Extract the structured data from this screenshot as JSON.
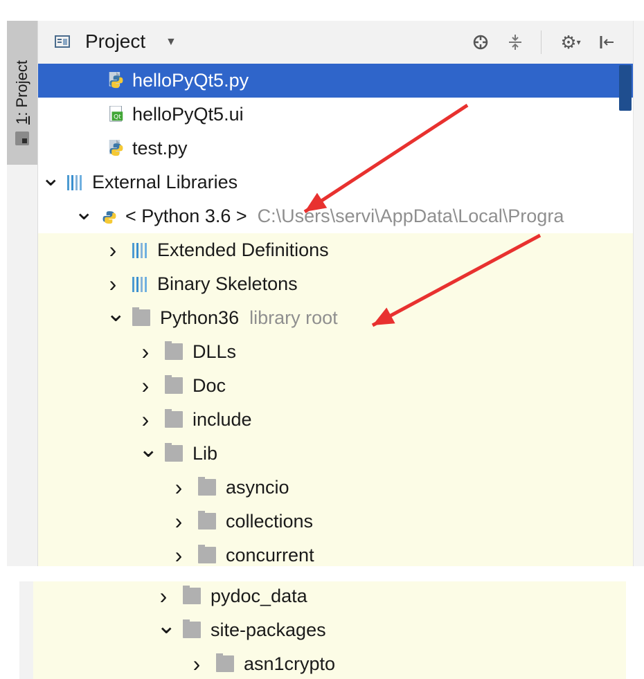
{
  "window": {
    "tool_tab": {
      "number": "1",
      "label": ": Project"
    }
  },
  "header": {
    "title": "Project",
    "icons": [
      "project-view-icon",
      "locate-icon",
      "collapse-all-icon",
      "settings-icon",
      "hide-icon"
    ]
  },
  "tree": [
    {
      "label": "helloPyQt5.py",
      "icon": "python-file-icon",
      "selected": true
    },
    {
      "label": "helloPyQt5.ui",
      "icon": "qt-ui-file-icon"
    },
    {
      "label": "test.py",
      "icon": "python-file-icon"
    },
    {
      "label": "External Libraries",
      "icon": "library-icon",
      "expanded": true
    },
    {
      "label": "< Python 3.6 >",
      "hint": "C:\\Users\\servi\\AppData\\Local\\Progra",
      "icon": "python-sdk-icon",
      "expanded": true
    },
    {
      "label": "Extended Definitions",
      "icon": "library-icon",
      "expanded": false
    },
    {
      "label": "Binary Skeletons",
      "icon": "library-icon",
      "expanded": false
    },
    {
      "label": "Python36",
      "hint": "library root",
      "icon": "folder-icon",
      "expanded": true
    },
    {
      "label": "DLLs",
      "icon": "folder-icon",
      "expanded": false
    },
    {
      "label": "Doc",
      "icon": "folder-icon",
      "expanded": false
    },
    {
      "label": "include",
      "icon": "folder-icon",
      "expanded": false
    },
    {
      "label": "Lib",
      "icon": "folder-icon",
      "expanded": true
    },
    {
      "label": "asyncio",
      "icon": "folder-icon",
      "expanded": false
    },
    {
      "label": "collections",
      "icon": "folder-icon",
      "expanded": false
    },
    {
      "label": "concurrent",
      "icon": "folder-icon",
      "expanded": false
    }
  ],
  "tree_lower": [
    {
      "label": "pydoc_data",
      "icon": "folder-icon",
      "expanded": false
    },
    {
      "label": "site-packages",
      "icon": "folder-icon",
      "expanded": true
    },
    {
      "label": "asn1crypto",
      "icon": "folder-icon",
      "expanded": false
    }
  ],
  "colors": {
    "selection": "#2f65ca",
    "library_root_bg": "#fcfce6",
    "annotation_arrow": "#e8312f"
  }
}
